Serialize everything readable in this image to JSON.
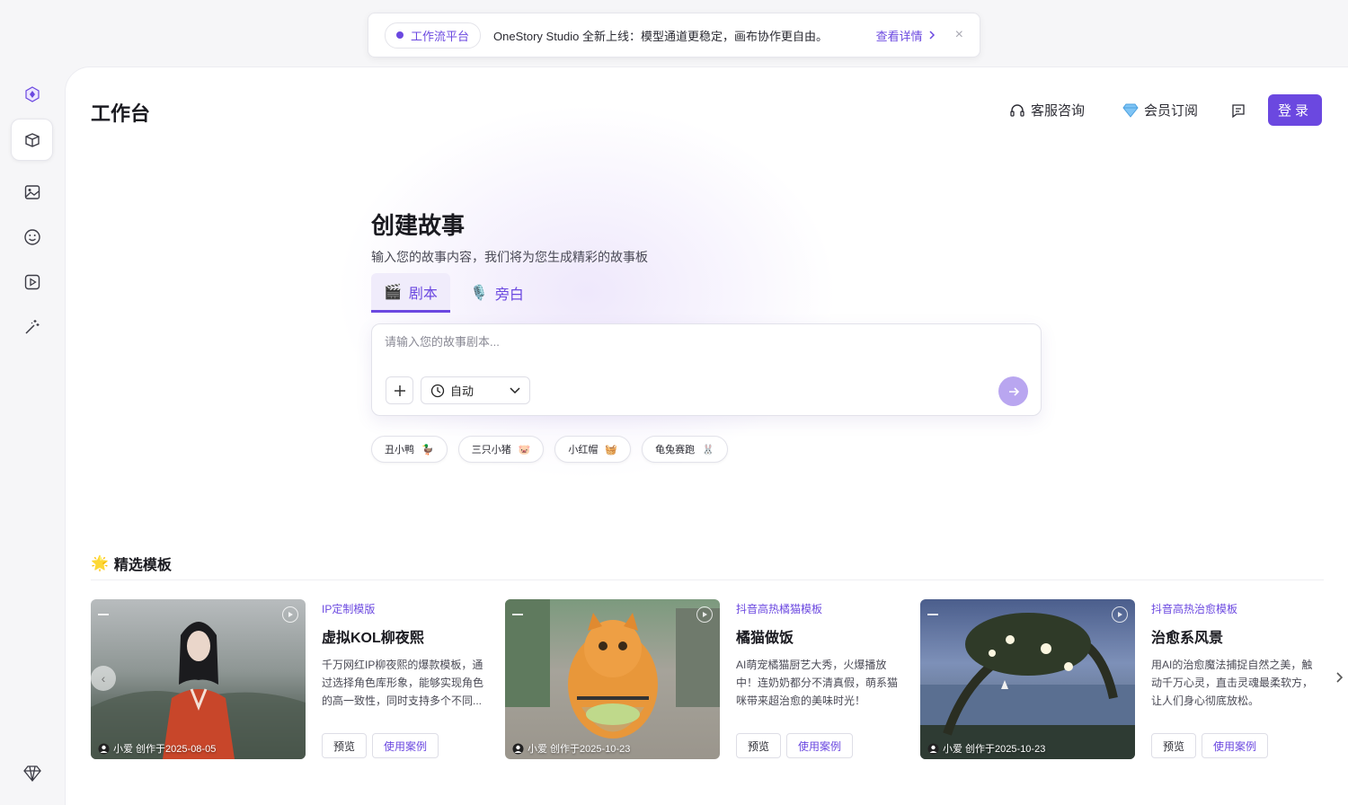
{
  "banner": {
    "chip_label": "工作流平台",
    "text": "OneStory Studio 全新上线：模型通道更稳定，画布协作更自由。",
    "link_label": "查看详情",
    "close_glyph": "×"
  },
  "sidebar": {
    "items": [
      {
        "icon": "cube-icon",
        "active": true
      },
      {
        "icon": "image-icon",
        "active": false
      },
      {
        "icon": "smile-icon",
        "active": false
      },
      {
        "icon": "video-play-icon",
        "active": false
      },
      {
        "icon": "magic-wand-icon",
        "active": false
      }
    ],
    "bottom_icon": "diamond-icon"
  },
  "header": {
    "title": "工作台",
    "support_label": "客服咨询",
    "membership_label": "会员订阅",
    "login_label": "登录"
  },
  "hero": {
    "title": "创建故事",
    "subtitle": "输入您的故事内容，我们将为您生成精彩的故事板",
    "tabs": [
      {
        "label": "剧本",
        "emoji": "🎬"
      },
      {
        "label": "旁白",
        "emoji": "🎙️"
      }
    ],
    "input_placeholder": "请输入您的故事剧本...",
    "mode_value": "自动",
    "chips": [
      {
        "label": "丑小鸭",
        "emoji": "🦆"
      },
      {
        "label": "三只小猪",
        "emoji": "🐷"
      },
      {
        "label": "小红帽",
        "emoji": "🧺"
      },
      {
        "label": "龟兔赛跑",
        "emoji": "🐰"
      }
    ]
  },
  "featured": {
    "title": "精选模板",
    "emoji": "🌟",
    "cards": [
      {
        "tag": "IP定制模版",
        "title": "虚拟KOL柳夜熙",
        "desc": "千万网红IP柳夜熙的爆款模板，通过选择角色库形象，能够实现角色的高一致性，同时支持多个不同...",
        "caption": "小爱 创作于2025-08-05",
        "preview_label": "预览",
        "usecase_label": "使用案例"
      },
      {
        "tag": "抖音高热橘猫模板",
        "title": "橘猫做饭",
        "desc": "AI萌宠橘猫厨艺大秀，火爆播放中！连奶奶都分不清真假，萌系猫咪带来超治愈的美味时光！",
        "caption": "小爱 创作于2025-10-23",
        "preview_label": "预览",
        "usecase_label": "使用案例"
      },
      {
        "tag": "抖音高热治愈模板",
        "title": "治愈系风景",
        "desc": "用AI的治愈魔法捕捉自然之美，触动千万心灵，直击灵魂最柔软方，让人们身心彻底放松。",
        "caption": "小爱 创作于2025-10-23",
        "preview_label": "预览",
        "usecase_label": "使用案例"
      }
    ]
  },
  "colors": {
    "accent": "#6b48e0",
    "accent_light": "#b9a6f0"
  }
}
